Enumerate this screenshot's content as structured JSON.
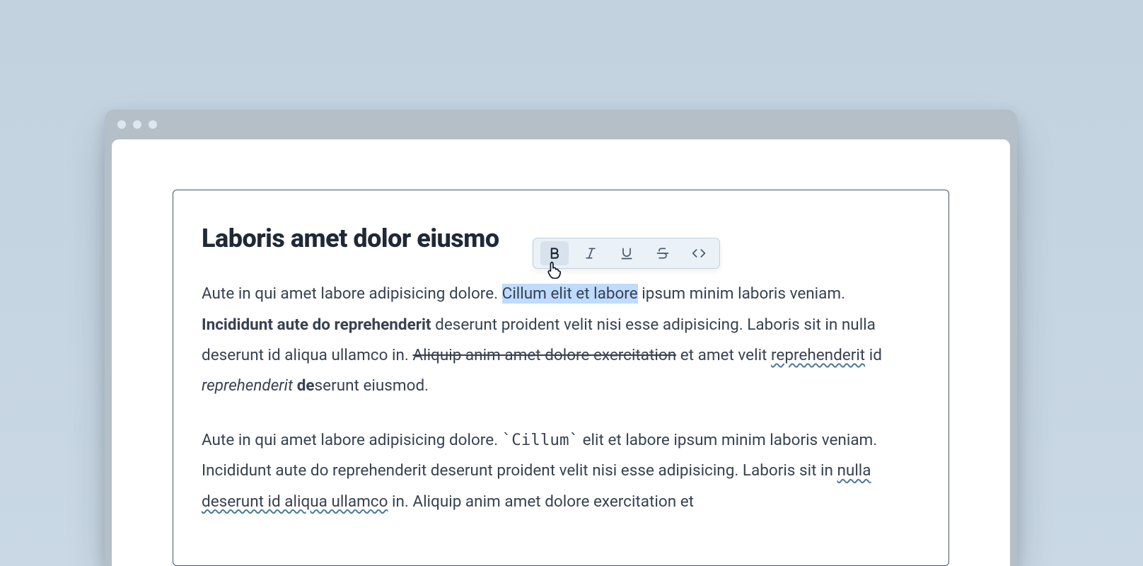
{
  "window": {
    "traffic_light_count": 3
  },
  "document": {
    "title": "Laboris amet dolor eiusmo",
    "paragraphs": [
      {
        "runs": [
          {
            "text": "Aute in qui amet labore adipisicing dolore. ",
            "style": "normal"
          },
          {
            "text": "Cillum elit et labore",
            "style": "highlight"
          },
          {
            "text": " ipsum minim laboris veniam. ",
            "style": "normal"
          },
          {
            "text": "Incididunt aute do reprehenderit",
            "style": "bold"
          },
          {
            "text": " deserunt proident velit nisi esse adipisicing. Laboris sit in nulla deserunt id aliqua ullamco in. ",
            "style": "normal"
          },
          {
            "text": "Aliquip anim amet dolore exercitation",
            "style": "strike"
          },
          {
            "text": " et amet velit ",
            "style": "normal"
          },
          {
            "text": "reprehenderit",
            "style": "wavy"
          },
          {
            "text": " id ",
            "style": "normal"
          },
          {
            "text": "reprehenderit",
            "style": "italic"
          },
          {
            "text": " ",
            "style": "normal"
          },
          {
            "text": "de",
            "style": "bold"
          },
          {
            "text": "serunt eiusmod.",
            "style": "normal"
          }
        ]
      },
      {
        "runs": [
          {
            "text": "Aute in qui amet labore adipisicing dolore. ",
            "style": "normal"
          },
          {
            "text": "`",
            "style": "tick"
          },
          {
            "text": "Cillum",
            "style": "code"
          },
          {
            "text": "`",
            "style": "tick"
          },
          {
            "text": " elit et labore ipsum minim laboris veniam. Incididunt aute do reprehenderit deserunt proident velit nisi esse adipisicing. Laboris sit in ",
            "style": "normal"
          },
          {
            "text": "nulla deserunt id aliqua ullamco",
            "style": "wavy"
          },
          {
            "text": " in. Aliquip anim amet dolore exercitation et",
            "style": "normal"
          }
        ]
      }
    ]
  },
  "toolbar": {
    "buttons": [
      {
        "name": "bold-button",
        "icon": "bold-icon",
        "active": true
      },
      {
        "name": "italic-button",
        "icon": "italic-icon",
        "active": false
      },
      {
        "name": "underline-button",
        "icon": "underline-icon",
        "active": false
      },
      {
        "name": "strikethrough-button",
        "icon": "strikethrough-icon",
        "active": false
      },
      {
        "name": "code-button",
        "icon": "code-icon",
        "active": false
      }
    ]
  }
}
